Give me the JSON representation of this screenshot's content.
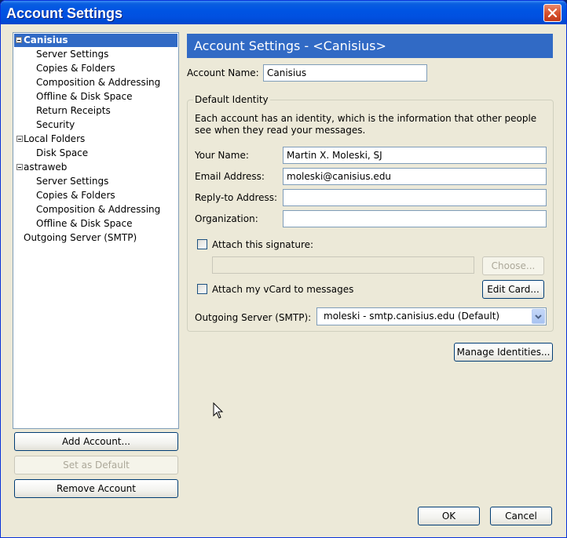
{
  "window": {
    "title": "Account Settings"
  },
  "tree": {
    "items": [
      {
        "label": "Canisius",
        "level": 0,
        "expandable": true,
        "selected": true
      },
      {
        "label": "Server Settings",
        "level": 1
      },
      {
        "label": "Copies & Folders",
        "level": 1
      },
      {
        "label": "Composition & Addressing",
        "level": 1
      },
      {
        "label": "Offline & Disk Space",
        "level": 1
      },
      {
        "label": "Return Receipts",
        "level": 1
      },
      {
        "label": "Security",
        "level": 1
      },
      {
        "label": "Local Folders",
        "level": 0,
        "expandable": true
      },
      {
        "label": "Disk Space",
        "level": 1
      },
      {
        "label": "astraweb",
        "level": 0,
        "expandable": true
      },
      {
        "label": "Server Settings",
        "level": 1
      },
      {
        "label": "Copies & Folders",
        "level": 1
      },
      {
        "label": "Composition & Addressing",
        "level": 1
      },
      {
        "label": "Offline & Disk Space",
        "level": 1
      },
      {
        "label": "Outgoing Server (SMTP)",
        "level": 0,
        "expandable": false
      }
    ]
  },
  "left_buttons": {
    "add_account": "Add Account...",
    "set_default": "Set as Default",
    "remove_account": "Remove Account"
  },
  "panel": {
    "header": "Account Settings - <Canisius>",
    "account_name_label": "Account Name:",
    "account_name_value": "Canisius",
    "identity": {
      "caption": "Default Identity",
      "description": "Each account has an identity, which is the information that other people see when they read your messages.",
      "your_name_label": "Your Name:",
      "your_name_value": "Martin X. Moleski, SJ",
      "email_label": "Email Address:",
      "email_value": "moleski@canisius.edu",
      "reply_to_label": "Reply-to Address:",
      "reply_to_value": "",
      "organization_label": "Organization:",
      "organization_value": "",
      "attach_signature_label": "Attach this signature:",
      "signature_path": "",
      "choose_button": "Choose...",
      "attach_vcard_label": "Attach my vCard to messages",
      "edit_card_button": "Edit Card...",
      "outgoing_label": "Outgoing Server (SMTP):",
      "outgoing_value": "moleski - smtp.canisius.edu (Default)"
    },
    "manage_identities_button": "Manage Identities..."
  },
  "footer": {
    "ok": "OK",
    "cancel": "Cancel"
  },
  "icons": {
    "close": "close-icon",
    "expander": "collapse-icon",
    "dropdown": "chevron-down-icon",
    "cursor": "mouse-pointer-icon"
  }
}
